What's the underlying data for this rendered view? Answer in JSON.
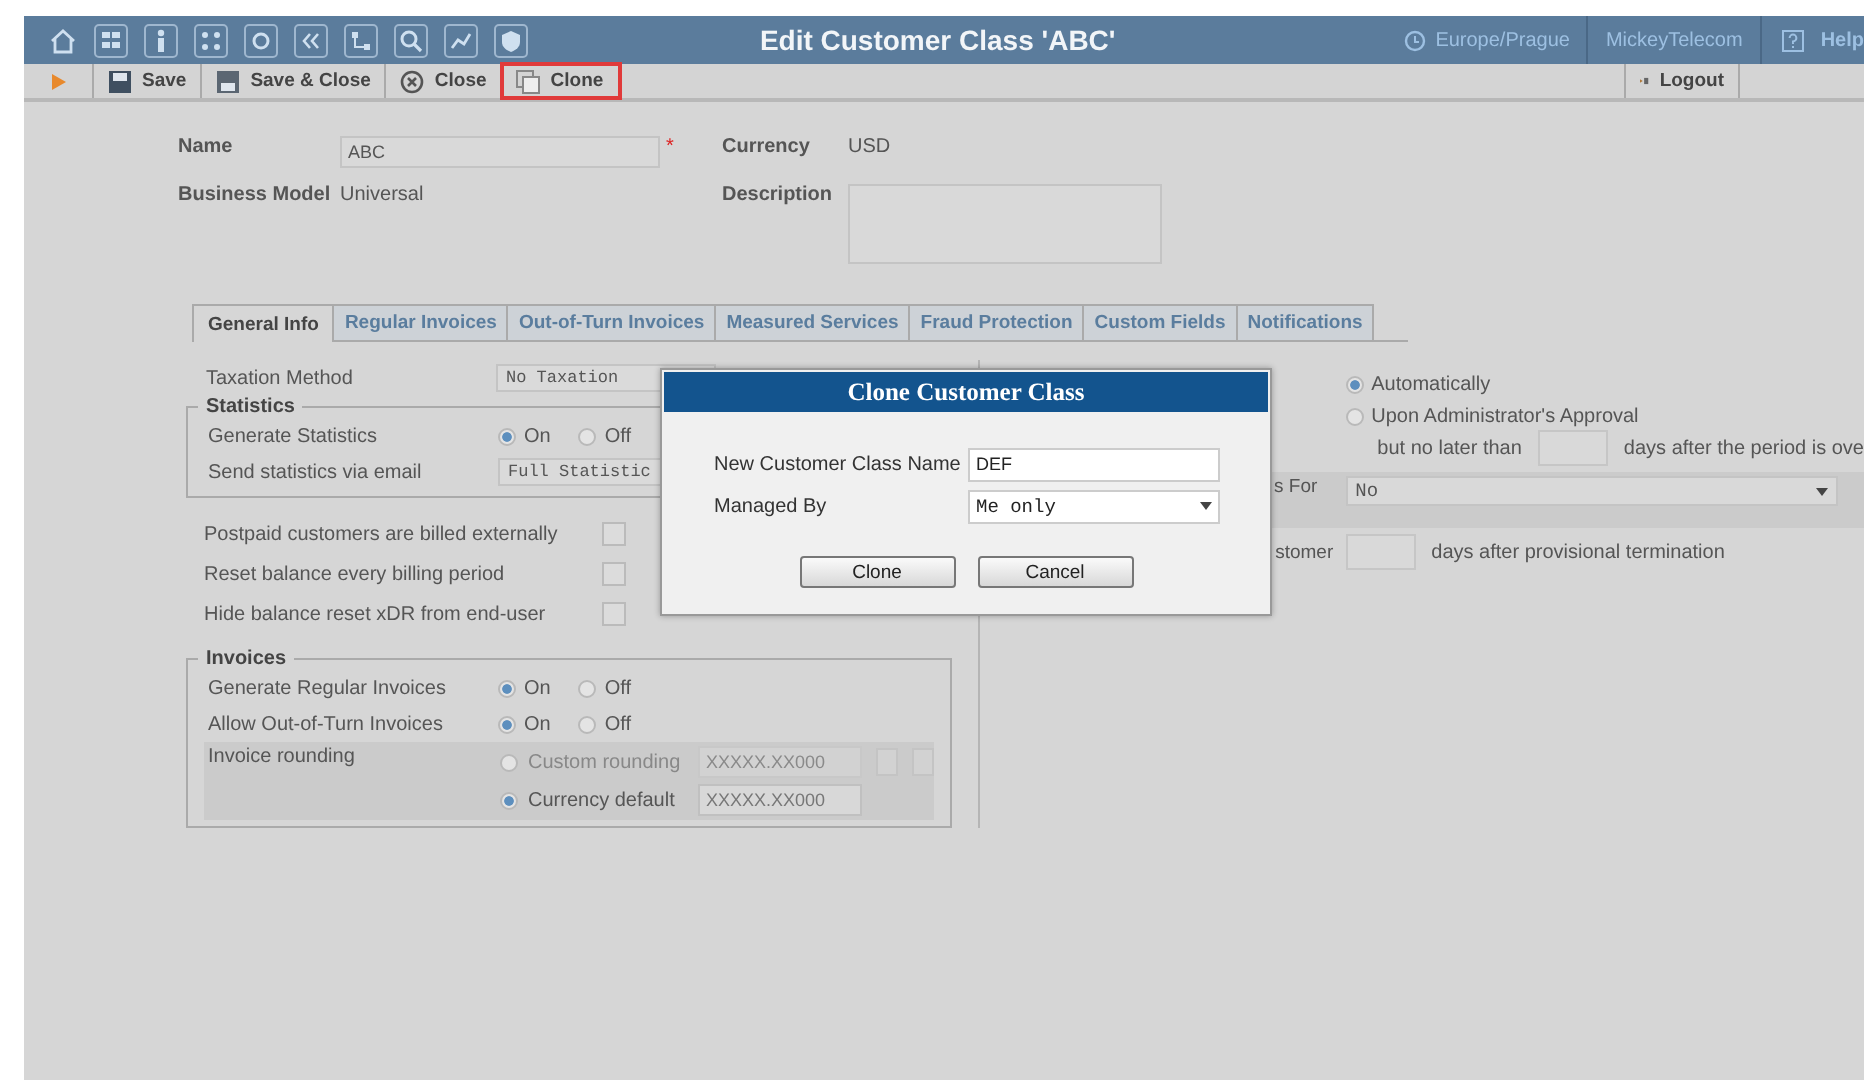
{
  "top_bar": {
    "title": "Edit Customer Class 'ABC'",
    "timezone": "Europe/Prague",
    "user": "MickeyTelecom",
    "help": "Help"
  },
  "toolbar": {
    "buttons": [
      {
        "label": "Save",
        "kind": "save",
        "highlighted": false
      },
      {
        "label": "Save & Close",
        "kind": "save-close",
        "highlighted": false
      },
      {
        "label": "Close",
        "kind": "close",
        "highlighted": false
      },
      {
        "label": "Clone",
        "kind": "clone",
        "highlighted": true
      }
    ],
    "logout": "Logout"
  },
  "header_form": {
    "name_label": "Name",
    "name_value": "ABC",
    "required_mark": "*",
    "business_model_label": "Business Model",
    "business_model": "Universal",
    "currency_label": "Currency",
    "currency": "USD",
    "description_label": "Description"
  },
  "tabs": [
    {
      "label": "General Info",
      "selected": true
    },
    {
      "label": "Regular Invoices",
      "selected": false
    },
    {
      "label": "Out-of-Turn Invoices",
      "selected": false
    },
    {
      "label": "Measured Services",
      "selected": false
    },
    {
      "label": "Fraud Protection",
      "selected": false
    },
    {
      "label": "Custom Fields",
      "selected": false
    },
    {
      "label": "Notifications",
      "selected": false
    }
  ],
  "general_info": {
    "taxation_label": "Taxation Method",
    "taxation_value": "No Taxation",
    "statistics": {
      "legend": "Statistics",
      "generate_label": "Generate Statistics",
      "generate_options": [
        {
          "label": "On",
          "selected": true
        },
        {
          "label": "Off",
          "selected": false
        }
      ],
      "email_label": "Send statistics via email",
      "email_value": "Full Statistic"
    },
    "checkboxes": [
      {
        "label": "Postpaid customers are billed externally",
        "checked": false
      },
      {
        "label": "Reset balance every billing period",
        "checked": false
      },
      {
        "label": "Hide balance reset xDR from end-user",
        "checked": false
      }
    ],
    "invoices": {
      "legend": "Invoices",
      "rows": [
        {
          "label": "Generate Regular Invoices",
          "options": [
            {
              "label": "On",
              "selected": true
            },
            {
              "label": "Off",
              "selected": false
            }
          ]
        },
        {
          "label": "Allow Out-of-Turn Invoices",
          "options": [
            {
              "label": "On",
              "selected": true
            },
            {
              "label": "Off",
              "selected": false
            }
          ]
        }
      ],
      "rounding_label": "Invoice rounding",
      "rounding_options": [
        {
          "label": "Custom rounding",
          "selected": false,
          "value": "XXXXX.XX000",
          "disabled": true
        },
        {
          "label": "Currency default",
          "selected": true,
          "value": "XXXXX.XX000",
          "disabled": false
        }
      ]
    }
  },
  "right_panel": {
    "approval_options": [
      {
        "label": "Automatically",
        "selected": true
      },
      {
        "label": "Upon Administrator's Approval",
        "selected": false
      }
    ],
    "no_later_label": "but no later than",
    "no_later_suffix": "days after the period is ove",
    "for_label": "s For",
    "for_value": "No",
    "customer_label": "stomer",
    "customer_suffix": "days after provisional termination"
  },
  "dialog": {
    "title": "Clone Customer Class",
    "name_label": "New Customer Class Name",
    "name_value": "DEF",
    "managed_label": "Managed By",
    "managed_value": "Me only",
    "buttons": [
      "Clone",
      "Cancel"
    ]
  }
}
